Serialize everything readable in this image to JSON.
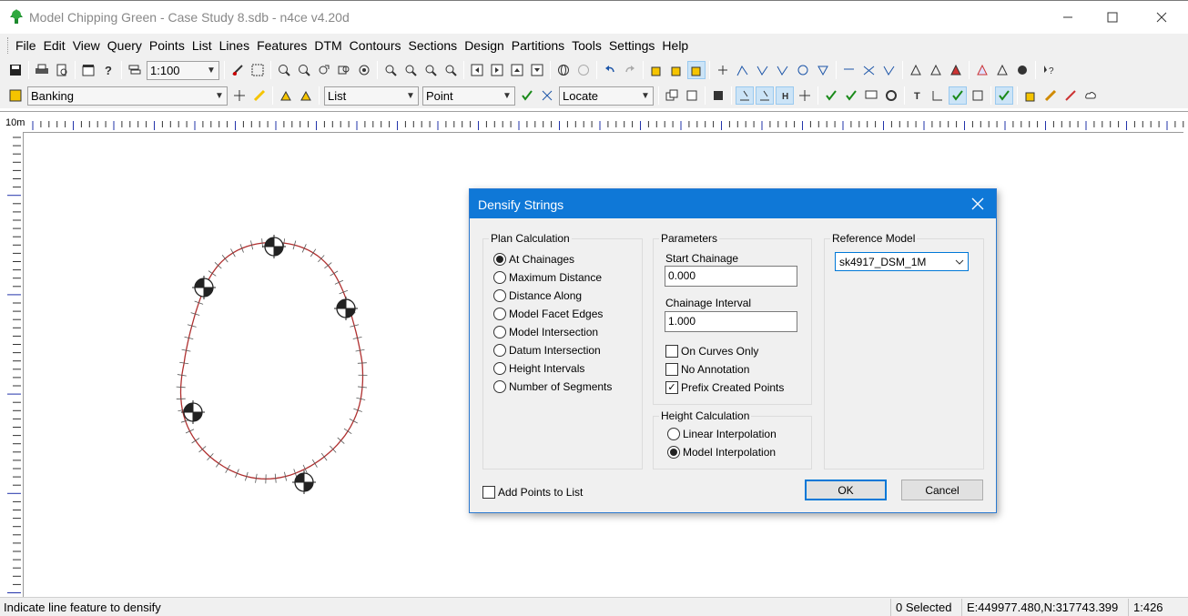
{
  "window": {
    "title": "Model Chipping Green - Case Study 8.sdb - n4ce v4.20d",
    "minimize_icon": "minimize-icon",
    "maximize_icon": "maximize-icon",
    "close_icon": "close-icon"
  },
  "menu": [
    "File",
    "Edit",
    "View",
    "Query",
    "Points",
    "List",
    "Lines",
    "Features",
    "DTM",
    "Contours",
    "Sections",
    "Design",
    "Partitions",
    "Tools",
    "Settings",
    "Help"
  ],
  "toolbar1": {
    "scale_value": "1:100"
  },
  "toolbar2": {
    "layer_value": "Banking",
    "list_value": "List",
    "point_value": "Point",
    "locate_value": "Locate"
  },
  "canvas": {
    "ruler_label": "10m"
  },
  "dialog": {
    "title": "Densify Strings",
    "plan_calc": {
      "label": "Plan Calculation",
      "options": [
        "At Chainages",
        "Maximum Distance",
        "Distance Along",
        "Model Facet Edges",
        "Model Intersection",
        "Datum Intersection",
        "Height Intervals",
        "Number of Segments"
      ],
      "selected": 0
    },
    "parameters": {
      "label": "Parameters",
      "start_chainage_label": "Start Chainage",
      "start_chainage_value": "0.000",
      "chainage_interval_label": "Chainage Interval",
      "chainage_interval_value": "1.000",
      "on_curves_only_label": "On Curves Only",
      "on_curves_only_checked": false,
      "no_annotation_label": "No Annotation",
      "no_annotation_checked": false,
      "prefix_created_points_label": "Prefix Created Points",
      "prefix_created_points_checked": true
    },
    "height_calc": {
      "label": "Height Calculation",
      "options": [
        "Linear Interpolation",
        "Model Interpolation"
      ],
      "selected": 1
    },
    "reference_model": {
      "label": "Reference Model",
      "value": "sk4917_DSM_1M"
    },
    "add_points_to_list_label": "Add Points to List",
    "add_points_to_list_checked": false,
    "ok_label": "OK",
    "cancel_label": "Cancel"
  },
  "status": {
    "message": "Indicate line feature to densify",
    "selected": "0 Selected",
    "coords": "E:449977.480,N:317743.399",
    "scale": "1:426"
  }
}
